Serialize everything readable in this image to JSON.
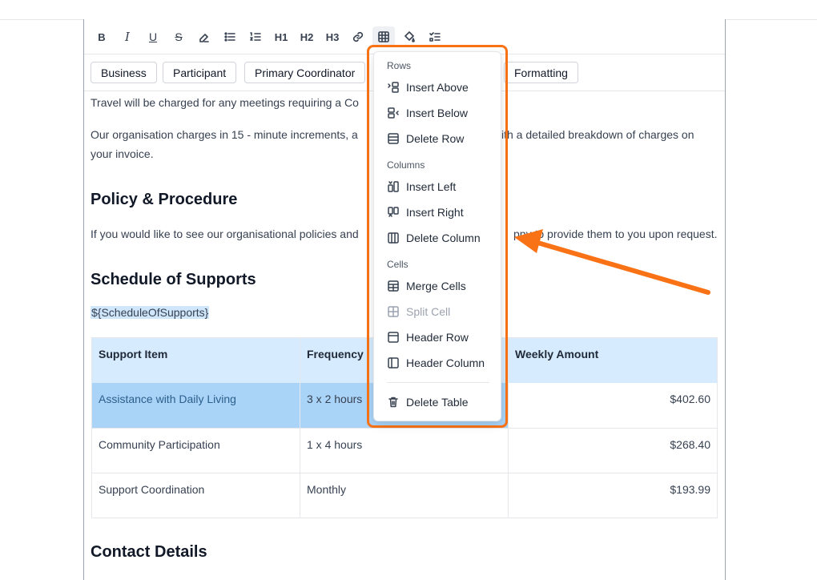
{
  "toolbar": {
    "buttons": [
      {
        "name": "bold-icon",
        "label": "B"
      },
      {
        "name": "italic-icon",
        "label": "I"
      },
      {
        "name": "underline-icon",
        "label": "U"
      },
      {
        "name": "strikethrough-icon",
        "label": "S"
      },
      {
        "name": "eraser-icon",
        "label": ""
      },
      {
        "name": "bullet-list-icon",
        "label": ""
      },
      {
        "name": "numbered-list-icon",
        "label": ""
      },
      {
        "name": "h1-button",
        "label": "H1"
      },
      {
        "name": "h2-button",
        "label": "H2"
      },
      {
        "name": "h3-button",
        "label": "H3"
      },
      {
        "name": "link-icon",
        "label": ""
      },
      {
        "name": "table-icon",
        "label": ""
      },
      {
        "name": "paint-bucket-icon",
        "label": ""
      },
      {
        "name": "checklist-icon",
        "label": ""
      }
    ],
    "h1": "H1",
    "h2": "H2",
    "h3": "H3"
  },
  "variable_chips": [
    "Business",
    "Participant",
    "Primary Coordinator",
    "Formatting"
  ],
  "content": {
    "p1": "Travel will be charged for any meetings requiring a Co",
    "p2a": "Our organisation charges in 15 - minute increments, a",
    "p2b": "ith a detailed breakdown of charges on",
    "p2c": "your invoice.",
    "h_policy": "Policy & Procedure",
    "p3a": "If you would like to see our organisational policies and",
    "p3b": "ppy to provide them to you upon request.",
    "h_schedule": "Schedule of Supports",
    "schedule_var": "${ScheduleOfSupports}",
    "h_contact": "Contact Details"
  },
  "table": {
    "headers": [
      "Support Item",
      "Frequency",
      "Weekly Amount"
    ],
    "rows": [
      [
        "Assistance with Daily Living",
        "3 x 2 hours",
        "$402.60"
      ],
      [
        "Community Participation",
        "1 x 4 hours",
        "$268.40"
      ],
      [
        "Support Coordination",
        "Monthly",
        "$193.99"
      ]
    ]
  },
  "menu": {
    "rows_label": "Rows",
    "insert_above": "Insert Above",
    "insert_below": "Insert Below",
    "delete_row": "Delete Row",
    "columns_label": "Columns",
    "insert_left": "Insert Left",
    "insert_right": "Insert Right",
    "delete_column": "Delete Column",
    "cells_label": "Cells",
    "merge_cells": "Merge Cells",
    "split_cell": "Split Cell",
    "header_row": "Header Row",
    "header_column": "Header Column",
    "delete_table": "Delete Table"
  },
  "colors": {
    "highlight": "#f97316",
    "header_bg": "#d6ebfd",
    "selected_bg": "#a9d3f7"
  }
}
